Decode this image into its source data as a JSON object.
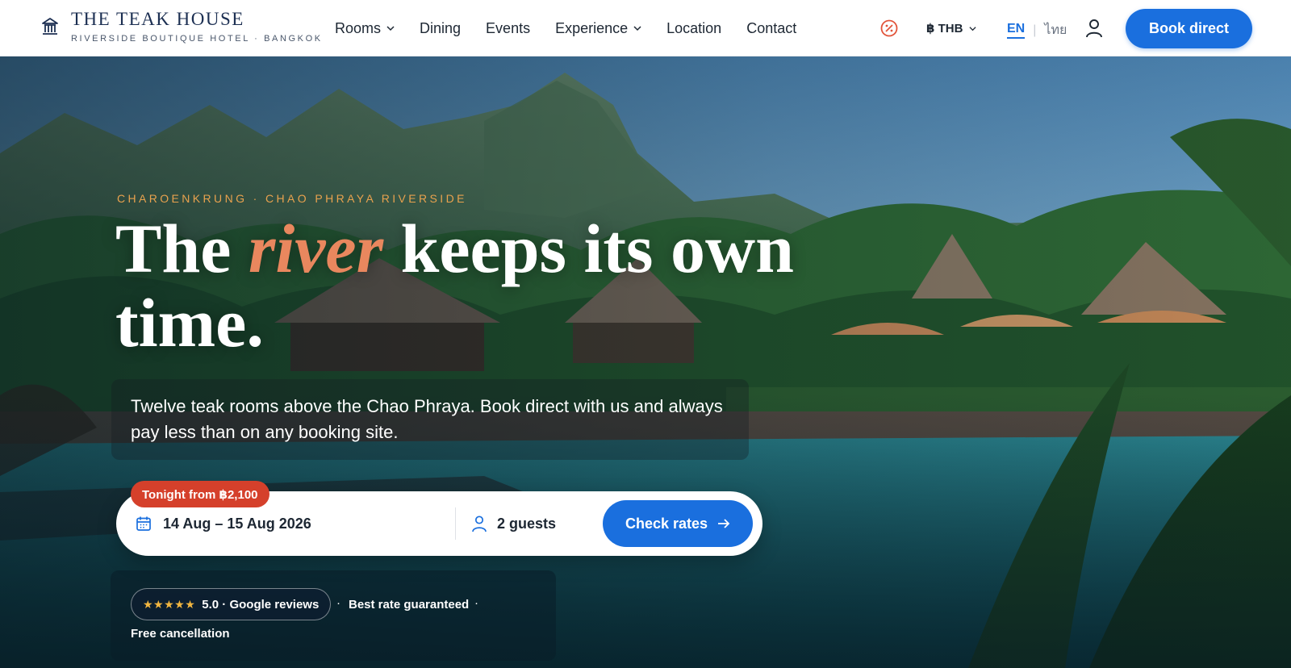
{
  "brand": {
    "name": "THE TEAK HOUSE",
    "tagline": "RIVERSIDE BOUTIQUE HOTEL · BANGKOK",
    "icon": "temple-icon"
  },
  "nav": {
    "items": [
      {
        "label": "Rooms",
        "has_dropdown": true
      },
      {
        "label": "Dining",
        "has_dropdown": false
      },
      {
        "label": "Events",
        "has_dropdown": false
      },
      {
        "label": "Experience",
        "has_dropdown": true
      },
      {
        "label": "Location",
        "has_dropdown": false
      },
      {
        "label": "Contact",
        "has_dropdown": false
      }
    ],
    "promo_icon": "discount-badge-icon",
    "currency": "฿ THB",
    "lang_en": "EN",
    "lang_th": "ไทย",
    "user_icon": "user-icon",
    "book_label": "Book direct"
  },
  "hero": {
    "eyebrow": "CHAROENKRUNG · CHAO PHRAYA RIVERSIDE",
    "headline_before": "The ",
    "headline_accent": "river",
    "headline_after": " keeps its own time.",
    "subtitle": "Twelve teak rooms above the Chao Phraya. Book direct with us and always pay less than on any booking site."
  },
  "booking": {
    "tonight_badge": "Tonight from ฿2,100",
    "dates": "14 Aug – 15 Aug 2026",
    "guests": "2 guests",
    "check_label": "Check rates"
  },
  "trust": {
    "stars": "★★★★★",
    "rating": "5.0 · Google reviews",
    "best_rate": "Best rate guaranteed",
    "free_cancel": "Free cancellation"
  },
  "colors": {
    "primary": "#1a6fde",
    "accent": "#e9875e",
    "eyebrow": "#e9a24e",
    "badge": "#d5402b",
    "brand_navy": "#1c2f52"
  }
}
